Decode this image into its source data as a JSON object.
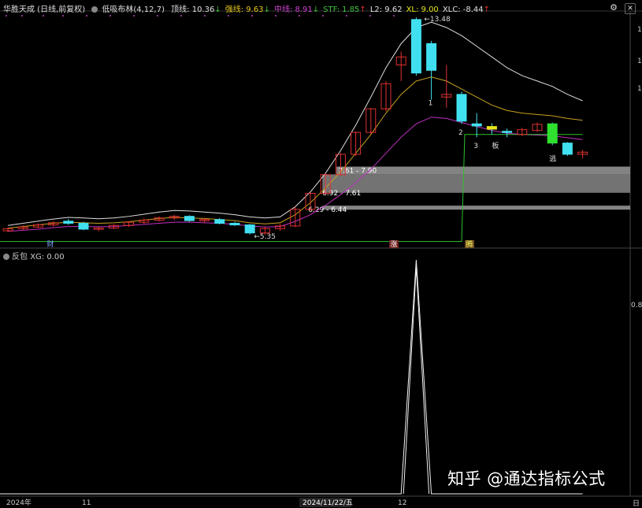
{
  "header": {
    "stock": "华胜天成 (日线,前复权)",
    "indicator": "低吸布林(4,12,7)",
    "items": [
      {
        "label": "顶线: 10.36",
        "color": "#e0e0e0",
        "arrow": "↓"
      },
      {
        "label": "强线: 9.63",
        "color": "#e6c619",
        "arrow": "↓"
      },
      {
        "label": "中线: 8.91",
        "color": "#d040d0",
        "arrow": "↓"
      },
      {
        "label": "STF: 1.85",
        "color": "#40c040",
        "arrow": "↑"
      },
      {
        "label": "L2: 9.62",
        "color": "#e0e0e0",
        "arrow": ""
      },
      {
        "label": "XL: 9.00",
        "color": "#e6e619",
        "arrow": ""
      },
      {
        "label": "XLC: -8.44",
        "color": "#e0e0e0",
        "arrow": "↑"
      }
    ]
  },
  "sub_header": {
    "label": "反包",
    "value_label": "XG: 0.00"
  },
  "window_controls": {
    "settings": "⚙",
    "close": "✕"
  },
  "axis": {
    "right_labels": [
      "1",
      "1",
      "1",
      "0.80"
    ],
    "right_corner": "日",
    "date_labels": [
      "2024年",
      "11",
      "2024/11/22/五",
      "12"
    ]
  },
  "markers": {
    "cai": "财",
    "zhang": "涨",
    "teng": "腾"
  },
  "annotations": {
    "high": "13.48",
    "low": "5.35",
    "zone1": "7.61 - 7.90",
    "zone2": "6.92 - 7.61",
    "zone3": "6.29 - 6.44",
    "seq1": "1",
    "seq2": "2",
    "seq3": "3",
    "ban": "板",
    "tao": "逃"
  },
  "watermark": "知乎 @通达指标公式",
  "colors": {
    "up": "#e03030",
    "down": "#40e0f0",
    "top": "#dddddd",
    "strong": "#c8a020",
    "mid": "#c030c0",
    "stf": "#30c030",
    "zone": "#9a9a9a"
  },
  "chart_data": {
    "type": "candlestick",
    "series": [
      {
        "open": 5.5,
        "high": 5.62,
        "low": 5.44,
        "close": 5.58
      },
      {
        "open": 5.58,
        "high": 5.7,
        "low": 5.52,
        "close": 5.64
      },
      {
        "open": 5.64,
        "high": 5.78,
        "low": 5.6,
        "close": 5.72
      },
      {
        "open": 5.72,
        "high": 5.86,
        "low": 5.66,
        "close": 5.8
      },
      {
        "open": 5.86,
        "high": 5.94,
        "low": 5.72,
        "close": 5.78
      },
      {
        "open": 5.78,
        "high": 5.84,
        "low": 5.52,
        "close": 5.56
      },
      {
        "open": 5.56,
        "high": 5.66,
        "low": 5.48,
        "close": 5.6
      },
      {
        "open": 5.6,
        "high": 5.74,
        "low": 5.56,
        "close": 5.7
      },
      {
        "open": 5.7,
        "high": 5.86,
        "low": 5.64,
        "close": 5.82
      },
      {
        "open": 5.82,
        "high": 5.96,
        "low": 5.76,
        "close": 5.9
      },
      {
        "open": 5.9,
        "high": 6.04,
        "low": 5.84,
        "close": 5.98
      },
      {
        "open": 5.98,
        "high": 6.1,
        "low": 5.9,
        "close": 6.04
      },
      {
        "open": 6.04,
        "high": 6.08,
        "low": 5.84,
        "close": 5.88
      },
      {
        "open": 5.88,
        "high": 5.98,
        "low": 5.8,
        "close": 5.92
      },
      {
        "open": 5.92,
        "high": 5.98,
        "low": 5.74,
        "close": 5.78
      },
      {
        "open": 5.78,
        "high": 5.84,
        "low": 5.68,
        "close": 5.72
      },
      {
        "open": 5.72,
        "high": 5.76,
        "low": 5.36,
        "close": 5.42
      },
      {
        "open": 5.42,
        "high": 5.66,
        "low": 5.35,
        "close": 5.58
      },
      {
        "open": 5.58,
        "high": 5.76,
        "low": 5.5,
        "close": 5.68
      },
      {
        "open": 5.68,
        "high": 6.4,
        "low": 5.64,
        "close": 6.3
      },
      {
        "open": 6.3,
        "high": 6.92,
        "low": 6.26,
        "close": 6.9
      },
      {
        "open": 6.9,
        "high": 7.64,
        "low": 6.86,
        "close": 7.6
      },
      {
        "open": 7.6,
        "high": 8.4,
        "low": 7.56,
        "close": 8.36
      },
      {
        "open": 8.36,
        "high": 9.22,
        "low": 8.3,
        "close": 9.18
      },
      {
        "open": 9.18,
        "high": 10.1,
        "low": 9.12,
        "close": 10.06
      },
      {
        "open": 10.06,
        "high": 11.1,
        "low": 9.96,
        "close": 11.0
      },
      {
        "open": 11.7,
        "high": 12.2,
        "low": 11.1,
        "close": 12.0
      },
      {
        "open": 13.4,
        "high": 13.48,
        "low": 11.3,
        "close": 11.4
      },
      {
        "open": 12.5,
        "high": 12.6,
        "low": 10.4,
        "close": 11.5
      },
      {
        "open": 10.5,
        "high": 11.7,
        "low": 10.1,
        "close": 10.6
      },
      {
        "open": 10.6,
        "high": 10.7,
        "low": 9.5,
        "close": 9.6
      },
      {
        "open": 9.5,
        "high": 9.9,
        "low": 9.0,
        "close": 9.42
      },
      {
        "open": 9.4,
        "high": 9.52,
        "low": 9.1,
        "close": 9.3
      },
      {
        "open": 9.22,
        "high": 9.32,
        "low": 9.0,
        "close": 9.2
      },
      {
        "open": 9.1,
        "high": 9.35,
        "low": 9.05,
        "close": 9.28
      },
      {
        "open": 9.25,
        "high": 9.55,
        "low": 9.2,
        "close": 9.48
      },
      {
        "open": 9.5,
        "high": 9.55,
        "low": 8.7,
        "close": 8.78
      },
      {
        "open": 8.78,
        "high": 8.82,
        "low": 8.3,
        "close": 8.36
      },
      {
        "open": 8.36,
        "high": 8.52,
        "low": 8.2,
        "close": 8.44
      }
    ],
    "lines": {
      "top": [
        5.7,
        5.78,
        5.86,
        5.94,
        6.0,
        5.98,
        5.95,
        5.98,
        6.04,
        6.12,
        6.2,
        6.26,
        6.24,
        6.2,
        6.16,
        6.1,
        6.02,
        5.98,
        6.02,
        6.4,
        6.95,
        7.65,
        8.5,
        9.45,
        10.5,
        11.6,
        12.5,
        13.1,
        13.3,
        13.1,
        12.8,
        12.4,
        12.0,
        11.6,
        11.3,
        11.1,
        10.9,
        10.6,
        10.36
      ],
      "strong": [
        5.6,
        5.66,
        5.72,
        5.78,
        5.82,
        5.8,
        5.78,
        5.8,
        5.84,
        5.9,
        5.96,
        6.0,
        5.98,
        5.96,
        5.92,
        5.88,
        5.8,
        5.76,
        5.8,
        6.1,
        6.55,
        7.1,
        7.7,
        8.4,
        9.1,
        9.9,
        10.6,
        11.1,
        11.25,
        11.1,
        10.8,
        10.5,
        10.2,
        10.0,
        9.9,
        9.85,
        9.8,
        9.7,
        9.63
      ],
      "mid": [
        5.48,
        5.52,
        5.56,
        5.62,
        5.66,
        5.66,
        5.65,
        5.66,
        5.7,
        5.74,
        5.78,
        5.82,
        5.82,
        5.8,
        5.78,
        5.74,
        5.68,
        5.64,
        5.66,
        5.85,
        6.1,
        6.45,
        6.85,
        7.3,
        7.8,
        8.4,
        9.0,
        9.5,
        9.75,
        9.7,
        9.55,
        9.4,
        9.25,
        9.15,
        9.1,
        9.08,
        9.05,
        8.98,
        8.91
      ]
    },
    "stf": {
      "base": 5.1,
      "jump_to": 9.1,
      "jump_index": 30
    },
    "zones": [
      {
        "low": 7.61,
        "high": 7.9
      },
      {
        "low": 6.92,
        "high": 7.61
      },
      {
        "low": 6.29,
        "high": 6.44
      }
    ],
    "sub": {
      "name": "XG",
      "values": [
        0,
        0,
        0,
        0,
        0,
        0,
        0,
        0,
        0,
        0,
        0,
        0,
        0,
        0,
        0,
        0,
        0,
        0,
        0,
        0,
        0,
        0,
        0,
        0,
        0,
        0,
        0,
        1,
        0,
        0,
        0,
        0,
        0,
        0,
        0,
        0,
        0,
        0,
        0
      ],
      "right_label": "0.80"
    },
    "ylim": [
      5.0,
      13.6
    ]
  }
}
